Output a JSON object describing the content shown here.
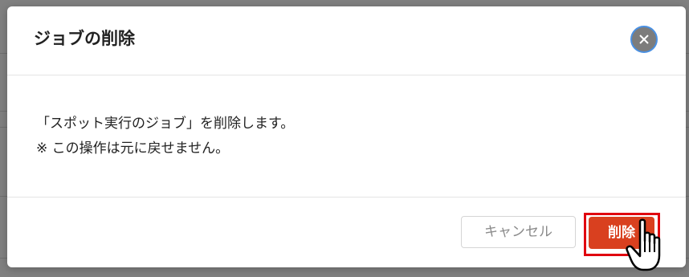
{
  "dialog": {
    "title": "ジョブの削除",
    "message": "「スポット実行のジョブ」を削除します。",
    "note": "※ この操作は元に戻せません。"
  },
  "buttons": {
    "cancel_label": "キャンセル",
    "delete_label": "削除"
  },
  "icons": {
    "close": "close-icon",
    "cursor": "hand-pointer-icon"
  },
  "colors": {
    "delete_button": "#d9401f",
    "highlight_box": "#e0000f",
    "overlay": "#808080"
  }
}
